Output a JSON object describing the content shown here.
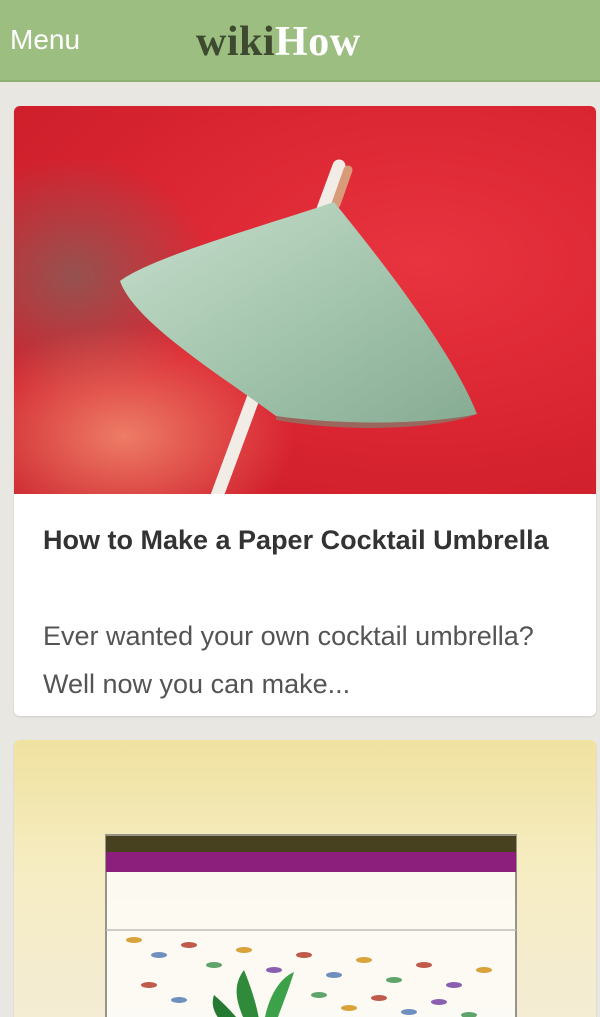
{
  "header": {
    "menu_label": "Menu",
    "logo_wiki": "wiki",
    "logo_how": "How",
    "bg_color": "#9cbe80"
  },
  "articles": [
    {
      "title": "How to Make a Paper Cocktail Umbrella",
      "description": "Ever wanted your own cocktail umbrella? Well now you can make...",
      "image": "paper-cocktail-umbrella-photo"
    },
    {
      "title": "",
      "description": "",
      "image": "fish-tank-illustration"
    }
  ]
}
